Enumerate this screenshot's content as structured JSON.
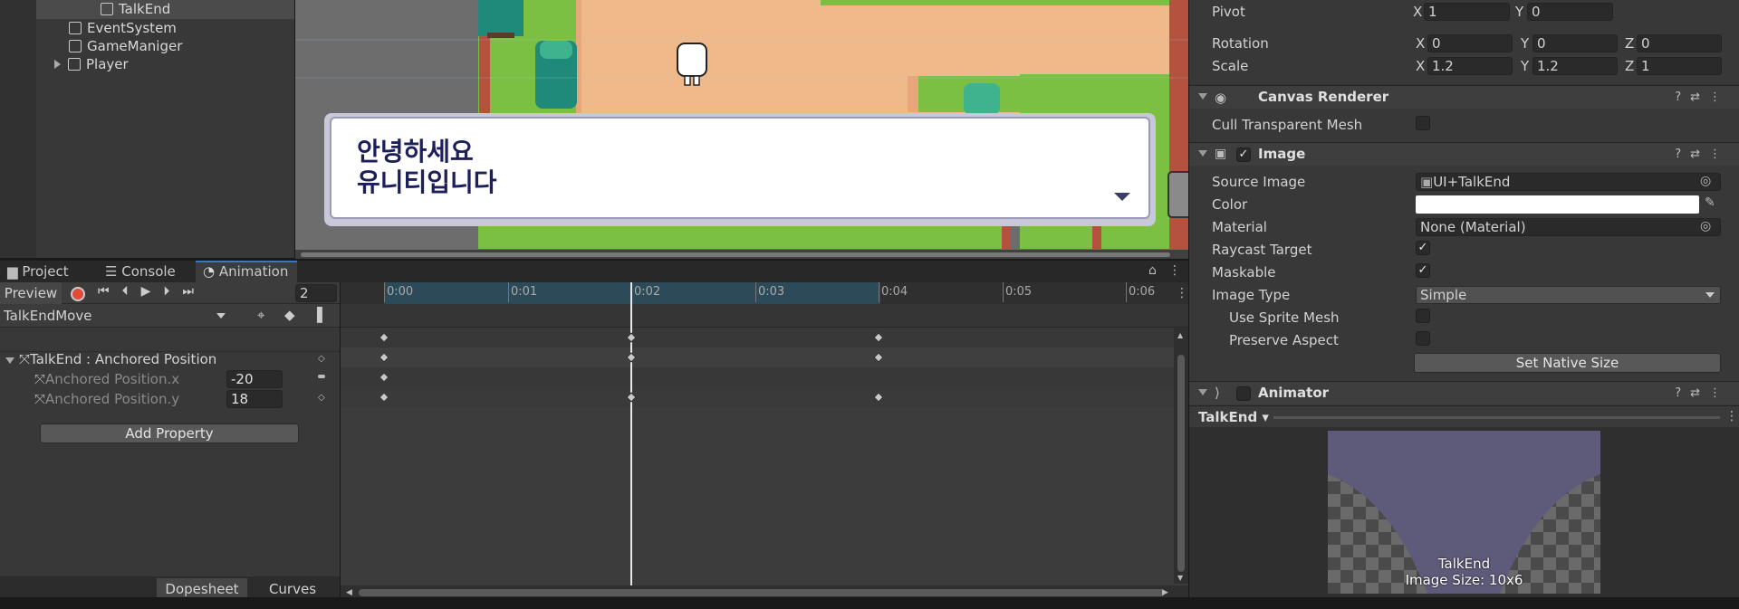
{
  "hierarchy": {
    "items": [
      {
        "label": "TalkEnd",
        "selected": true
      },
      {
        "label": "EventSystem"
      },
      {
        "label": "GameManiger"
      },
      {
        "label": "Player",
        "expandable": true
      }
    ]
  },
  "scene": {
    "dialog_line1": "안녕하세요",
    "dialog_line2": "유니티입니다"
  },
  "inspector": {
    "pivot_label": "Pivot",
    "pivot_x": "1",
    "pivot_y": "0",
    "rotation_label": "Rotation",
    "rotation_x": "0",
    "rotation_y": "0",
    "rotation_z": "0",
    "scale_label": "Scale",
    "scale_x": "1.2",
    "scale_y": "1.2",
    "scale_z": "1",
    "axis_x": "X",
    "axis_y": "Y",
    "axis_z": "Z",
    "canvas_renderer": {
      "title": "Canvas Renderer",
      "cull_label": "Cull Transparent Mesh",
      "cull_checked": false
    },
    "image": {
      "title": "Image",
      "source_image_label": "Source Image",
      "source_image_value": "UI+TalkEnd",
      "color_label": "Color",
      "color_value": "#ffffff",
      "material_label": "Material",
      "material_value": "None (Material)",
      "raycast_label": "Raycast Target",
      "maskable_label": "Maskable",
      "image_type_label": "Image Type",
      "image_type_value": "Simple",
      "use_sprite_mesh_label": "Use Sprite Mesh",
      "preserve_aspect_label": "Preserve Aspect",
      "set_native_size": "Set Native Size"
    },
    "animator": {
      "title": "Animator"
    },
    "preview": {
      "object": "TalkEnd",
      "name": "TalkEnd",
      "size": "Image Size: 10x6"
    }
  },
  "animation": {
    "tabs": [
      "Project",
      "Console",
      "Animation"
    ],
    "active_tab": "Animation",
    "preview_label": "Preview",
    "frame": "2",
    "clip": "TalkEndMove",
    "track_title": "TalkEnd : Anchored Position",
    "props": [
      {
        "label": "Anchored Position.x",
        "value": "-20"
      },
      {
        "label": "Anchored Position.y",
        "value": "18"
      }
    ],
    "add_property": "Add Property",
    "dopesheet": "Dopesheet",
    "curves": "Curves",
    "time_labels": [
      "0:00",
      "0:01",
      "0:02",
      "0:03",
      "0:04",
      "0:05",
      "0:06"
    ]
  },
  "colors": {
    "accent": "#3a79bb",
    "record": "#e24a3a",
    "dialog_text": "#1c1f5a",
    "grass": "#7cc043",
    "sand": "#f0b98a"
  }
}
